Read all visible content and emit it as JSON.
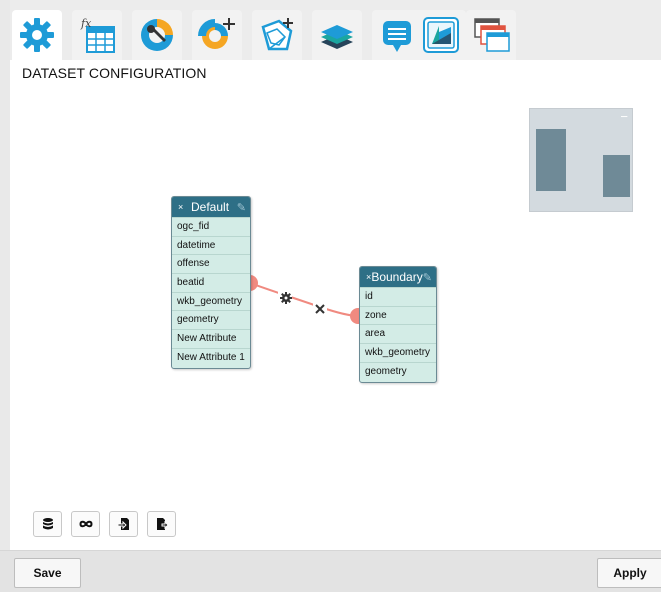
{
  "toolbar": {
    "tools": [
      {
        "icon": "gear-icon",
        "active": true
      },
      {
        "icon": "formula-table-icon",
        "glyph": "fx"
      },
      {
        "icon": "wrench-gauge-icon"
      },
      {
        "icon": "add-chart-icon"
      },
      {
        "icon": "add-map-icon"
      },
      {
        "icon": "layers-icon"
      },
      {
        "icon": "comment-icon"
      },
      {
        "icon": "app-logo-icon"
      },
      {
        "icon": "windows-icon"
      }
    ]
  },
  "section_title": "DATASET CONFIGURATION",
  "nodes": {
    "default": {
      "close": "×",
      "title": "Default",
      "edit": "✎",
      "attributes": [
        "ogc_fid",
        "datetime",
        "offense",
        "beatid",
        "wkb_geometry",
        "geometry",
        "New Attribute",
        "New Attribute 1"
      ]
    },
    "boundary": {
      "close": "×",
      "title": "Boundary",
      "edit": "✎",
      "attributes": [
        "id",
        "zone",
        "area",
        "wkb_geometry",
        "geometry"
      ]
    }
  },
  "link": {
    "from": "Default.beatid",
    "to": "Boundary.zone",
    "color": "#f08a80",
    "settings_icon": "gear-icon",
    "remove_icon": "close-icon"
  },
  "minimap": {
    "collapse_label": "−"
  },
  "bottom_tools": [
    {
      "icon": "database-icon"
    },
    {
      "icon": "infinity-icon"
    },
    {
      "icon": "import-file-icon"
    },
    {
      "icon": "export-file-icon"
    }
  ],
  "footer": {
    "save_label": "Save",
    "apply_label": "Apply"
  },
  "colors": {
    "node_header": "#2e6f86",
    "node_body": "#d3ece6",
    "accent_blue": "#1e9bd7",
    "accent_orange": "#f5a623"
  }
}
